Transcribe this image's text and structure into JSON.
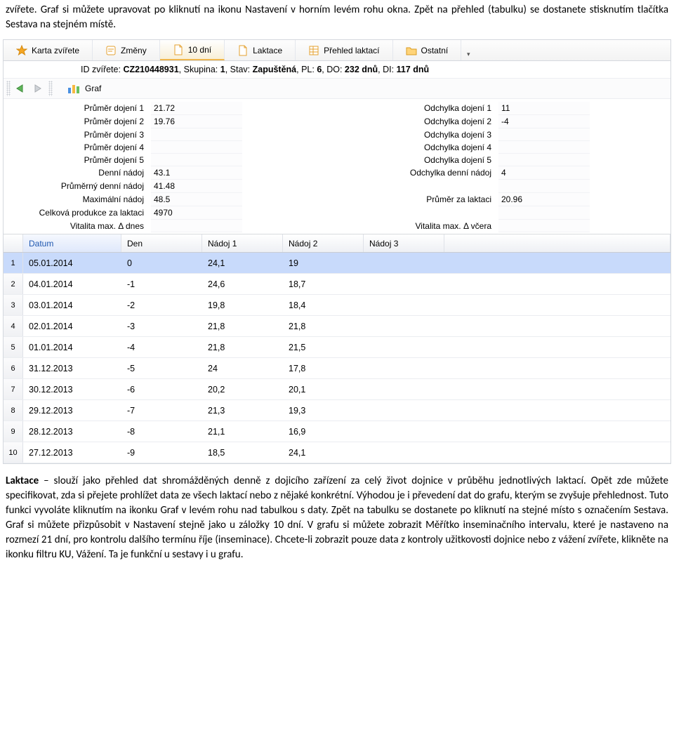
{
  "intro_text": "zvířete. Graf si můžete upravovat po kliknutí na ikonu Nastavení v horním levém rohu okna. Zpět na přehled (tabulku) se dostanete stisknutím tlačítka Sestava na stejném místě.",
  "tabs": {
    "items": [
      {
        "label": "Karta zvířete",
        "icon": "star"
      },
      {
        "label": "Změny",
        "icon": "note"
      },
      {
        "label": "10 dní",
        "icon": "page"
      },
      {
        "label": "Laktace",
        "icon": "page"
      },
      {
        "label": "Přehled laktací",
        "icon": "sheet"
      },
      {
        "label": "Ostatní",
        "icon": "folder"
      }
    ],
    "active_index": 2
  },
  "info": {
    "prefix": "ID zvířete: ",
    "id": "CZ210448931",
    "parts": ", Skupina: 1, Stav: Zapuštěná, PL: 6, DO: 232 dnů, DI: 117 dnů",
    "skupina": "1",
    "stav": "Zapuštěná",
    "pl": "6",
    "do": "232 dnů",
    "di": "117 dnů"
  },
  "graf_label": "Graf",
  "stats_left": [
    {
      "label": "Průměr dojení 1",
      "value": "21.72"
    },
    {
      "label": "Průměr dojení 2",
      "value": "19.76"
    },
    {
      "label": "Průměr dojení 3",
      "value": ""
    },
    {
      "label": "Průměr dojení 4",
      "value": ""
    },
    {
      "label": "Průměr dojení 5",
      "value": ""
    },
    {
      "label": "Denní nádoj",
      "value": "43.1"
    },
    {
      "label": "Průměrný denní nádoj",
      "value": "41.48"
    },
    {
      "label": "Maximální nádoj",
      "value": "48.5"
    },
    {
      "label": "Celková produkce za laktaci",
      "value": "4970"
    },
    {
      "label": "Vitalita max. Δ dnes",
      "value": ""
    }
  ],
  "stats_right": [
    {
      "label": "Odchylka dojení 1",
      "value": "11"
    },
    {
      "label": "Odchylka dojení 2",
      "value": "-4"
    },
    {
      "label": "Odchylka dojení 3",
      "value": ""
    },
    {
      "label": "Odchylka dojení 4",
      "value": ""
    },
    {
      "label": "Odchylka dojení 5",
      "value": ""
    },
    {
      "label": "Odchylka denní nádoj",
      "value": "4"
    },
    {
      "label": "",
      "value": ""
    },
    {
      "label": "Průměr za laktaci",
      "value": "20.96"
    },
    {
      "label": "",
      "value": ""
    },
    {
      "label": "Vitalita max. Δ včera",
      "value": ""
    }
  ],
  "table": {
    "columns": [
      "",
      "Datum",
      "Den",
      "Nádoj 1",
      "Nádoj 2",
      "Nádoj 3"
    ],
    "rows": [
      {
        "n": "1",
        "datum": "05.01.2014",
        "den": "0",
        "n1": "24,1",
        "n2": "19",
        "n3": ""
      },
      {
        "n": "2",
        "datum": "04.01.2014",
        "den": "-1",
        "n1": "24,6",
        "n2": "18,7",
        "n3": ""
      },
      {
        "n": "3",
        "datum": "03.01.2014",
        "den": "-2",
        "n1": "19,8",
        "n2": "18,4",
        "n3": ""
      },
      {
        "n": "4",
        "datum": "02.01.2014",
        "den": "-3",
        "n1": "21,8",
        "n2": "21,8",
        "n3": ""
      },
      {
        "n": "5",
        "datum": "01.01.2014",
        "den": "-4",
        "n1": "21,8",
        "n2": "21,5",
        "n3": ""
      },
      {
        "n": "6",
        "datum": "31.12.2013",
        "den": "-5",
        "n1": "24",
        "n2": "17,8",
        "n3": ""
      },
      {
        "n": "7",
        "datum": "30.12.2013",
        "den": "-6",
        "n1": "20,2",
        "n2": "20,1",
        "n3": ""
      },
      {
        "n": "8",
        "datum": "29.12.2013",
        "den": "-7",
        "n1": "21,3",
        "n2": "19,3",
        "n3": ""
      },
      {
        "n": "9",
        "datum": "28.12.2013",
        "den": "-8",
        "n1": "21,1",
        "n2": "16,9",
        "n3": ""
      },
      {
        "n": "10",
        "datum": "27.12.2013",
        "den": "-9",
        "n1": "18,5",
        "n2": "24,1",
        "n3": ""
      }
    ],
    "selected_row": 0
  },
  "outro": {
    "lead": "Laktace",
    "body": " – slouží jako přehled dat shromážděných denně z dojicího zařízení za celý život dojnice v průběhu jednotlivých laktací. Opět zde můžete specifikovat, zda si přejete prohlížet data ze všech laktací nebo z nějaké konkrétní. Výhodou je i převedení dat do grafu, kterým se zvyšuje přehlednost. Tuto funkci vyvoláte kliknutím na ikonku Graf v levém rohu nad tabulkou s daty. Zpět na tabulku se dostanete po kliknutí na stejné místo s označením Sestava. Graf si můžete přizpůsobit v Nastavení stejně jako u záložky 10 dní. V grafu si můžete zobrazit Měřítko inseminačního intervalu, které je nastaveno na rozmezí 21 dní, pro kontrolu dalšího termínu říje (inseminace). Chcete-li zobrazit pouze data z kontroly užitkovosti dojnice nebo z vážení zvířete, klikněte na ikonku filtru KU, Vážení. Ta je funkční u sestavy i u grafu."
  }
}
